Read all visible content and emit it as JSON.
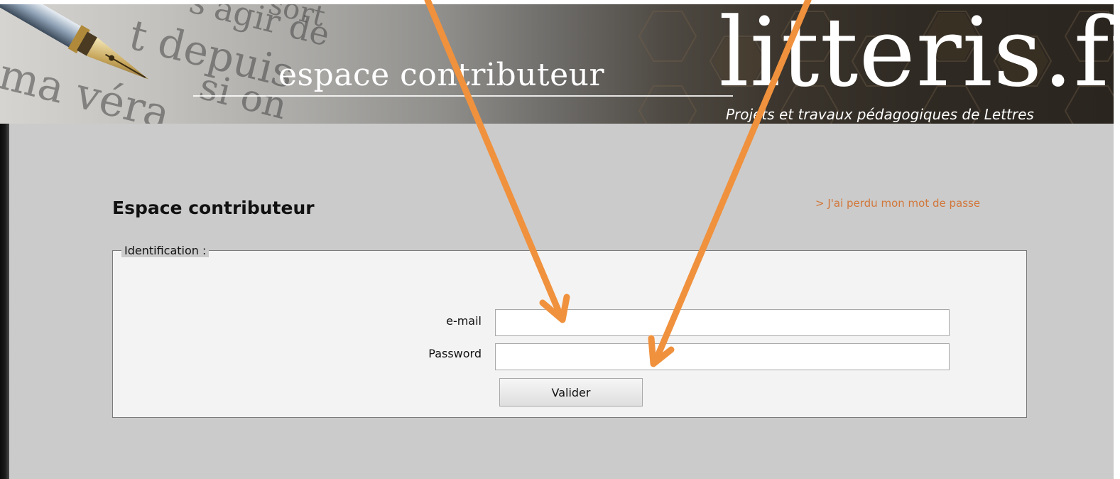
{
  "banner": {
    "subtitle": "espace contributeur",
    "brand": "litteris.fr",
    "tagline": "Projets et travaux pédagogiques de Lettres",
    "background_text": [
      "s'agir de",
      "sort",
      "t depuis",
      "si on",
      "ma véra"
    ]
  },
  "main": {
    "title": "Espace contributeur",
    "lost_password_link": "> J'ai perdu mon mot de passe",
    "fieldset": {
      "legend": "Identification :",
      "email_label": "e-mail",
      "email_value": "",
      "password_label": "Password",
      "password_value": "",
      "submit_label": "Valider"
    }
  },
  "annotations": {
    "arrow_color": "#f0913d",
    "arrows": [
      {
        "target": "email-input"
      },
      {
        "target": "password-input"
      }
    ]
  },
  "colors": {
    "page_background": "#cbcbcb",
    "link_color": "#d2773a",
    "fieldset_background": "#f3f3f3"
  },
  "icons": {
    "pen": "fountain-pen-icon"
  }
}
